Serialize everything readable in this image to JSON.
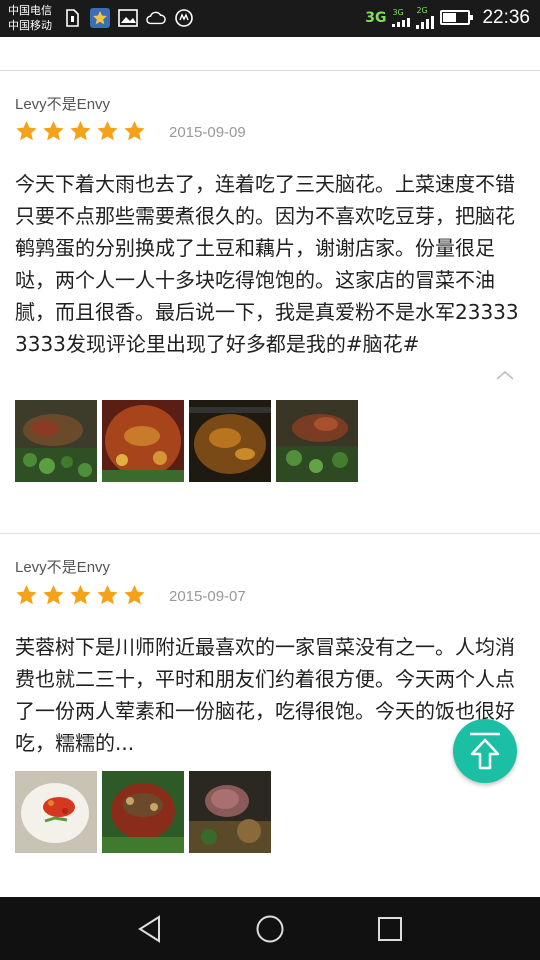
{
  "status_bar": {
    "carrier_1": "中国电信",
    "carrier_2": "中国移动",
    "network_main": "3G",
    "network_small_1": "3G",
    "network_small_2": "2G",
    "battery_level": 0.55,
    "time": "22:36"
  },
  "reviews": [
    {
      "username": "Levy不是Envy",
      "rating": 5,
      "date": "2015-09-09",
      "text": "今天下着大雨也去了，连着吃了三天脑花。上菜速度不错只要不点那些需要煮很久的。因为不喜欢吃豆芽，把脑花鹌鹑蛋的分别换成了土豆和藕片，谢谢店家。份量很足哒，两个人一人十多块吃得饱饱的。这家店的冒菜不油腻，而且很香。最后说一下，我是真爱粉不是水军233333333发现评论里出现了好多都是我的#脑花#",
      "photos": [
        "food-photo-1",
        "food-photo-2",
        "food-photo-3",
        "food-photo-4"
      ]
    },
    {
      "username": "Levy不是Envy",
      "rating": 5,
      "date": "2015-09-07",
      "text": "芙蓉树下是川师附近最喜欢的一家冒菜没有之一。人均消费也就二三十，平时和朋友们约着很方便。今天两个人点了一份两人荤素和一份脑花，吃得很饱。今天的饭也很好吃，糯糯的...",
      "photos": [
        "food-photo-5",
        "food-photo-6",
        "food-photo-7"
      ]
    }
  ],
  "colors": {
    "star": "#f5a21b",
    "fab": "#1bbfa3",
    "divider": "#e2e2e2"
  },
  "icons": {
    "collapse": "chevron-up-icon",
    "fab": "arrow-up-icon",
    "nav_back": "triangle-back-icon",
    "nav_home": "circle-home-icon",
    "nav_recent": "square-recent-icon"
  }
}
